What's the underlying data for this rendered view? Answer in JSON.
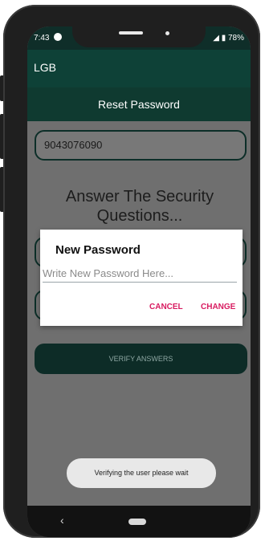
{
  "status": {
    "time": "7:43",
    "battery": "78%"
  },
  "app": {
    "title": "LGB"
  },
  "screen": {
    "header": "Reset Password",
    "phone_value": "9043076090",
    "question": "Answer The Security Questions...",
    "verify_label": "VERIFY ANSWERS"
  },
  "dialog": {
    "title": "New Password",
    "placeholder": "Write New Password Here...",
    "cancel": "CANCEL",
    "change": "CHANGE"
  },
  "toast": {
    "message": "Verifying the user please wait"
  },
  "colors": {
    "primary": "#0e4137",
    "accent": "#d81b60"
  },
  "icons": {
    "status_left": "signal-app-icon",
    "battery": "battery-icon",
    "back": "back-chevron-icon",
    "home": "home-pill-icon"
  }
}
